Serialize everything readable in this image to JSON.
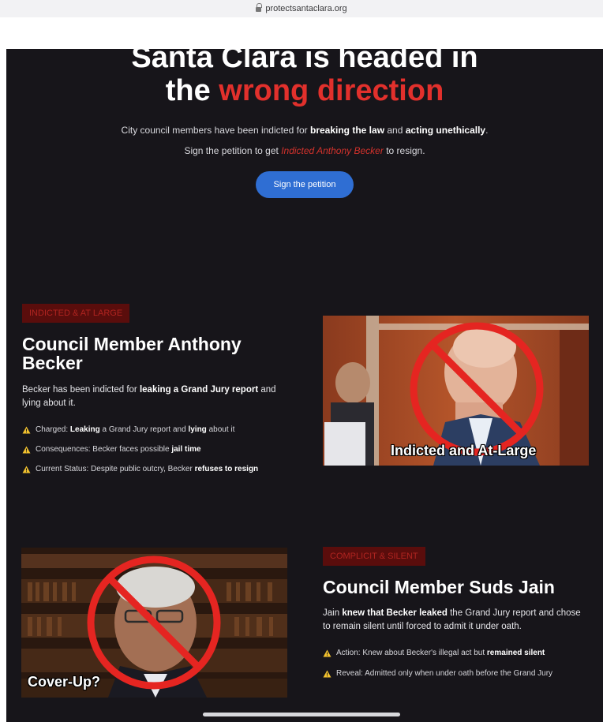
{
  "browser": {
    "url": "protectsantaclara.org"
  },
  "hero": {
    "title_line1": "Santa Clara is headed in",
    "title_line2_prefix": "the",
    "title_line2_red": "wrong direction",
    "sub_text1": "City council members have been indicted for",
    "sub_bold1": "breaking the law",
    "sub_text2": "and",
    "sub_bold2": "acting unethically",
    "sub_text3": ".",
    "sign_text1": "Sign the petition to get",
    "sign_red": "Indicted Anthony Becker",
    "sign_text2": "to resign.",
    "cta_label": "Sign the petition"
  },
  "becker": {
    "badge": "INDICTED & AT LARGE",
    "title": "Council Member Anthony Becker",
    "desc_pre": "Becker has been indicted for",
    "desc_bold": "leaking a Grand Jury report",
    "desc_post": "and lying about it.",
    "bullets": [
      {
        "pre": "Charged:",
        "b1": "Leaking",
        "mid": "a Grand Jury report and",
        "b2": "lying",
        "post": "about it"
      },
      {
        "pre": "Consequences: Becker faces possible",
        "b1": "jail time",
        "mid": "",
        "b2": "",
        "post": ""
      },
      {
        "pre": "Current Status: Despite public outcry, Becker",
        "b1": "refuses to resign",
        "mid": "",
        "b2": "",
        "post": ""
      }
    ],
    "photo_caption": "Indicted and At-Large"
  },
  "jain": {
    "badge": "COMPLICIT & SILENT",
    "title": "Council Member Suds Jain",
    "desc_pre": "Jain",
    "desc_bold": "knew that Becker leaked",
    "desc_post": "the Grand Jury report and chose to remain silent until forced to admit it under oath.",
    "bullets": [
      {
        "pre": "Action: Knew about Becker's illegal act but",
        "b1": "remained silent"
      },
      {
        "pre": "Reveal: Admitted only when under oath before the Grand Jury",
        "b1": ""
      }
    ],
    "photo_caption": "Cover-Up?"
  },
  "colors": {
    "background": "#17151a",
    "accent_red": "#e2302c",
    "button_blue": "#2f6ed3",
    "badge_bg": "#5a0d0c"
  },
  "icons": [
    "lock-icon",
    "warning-icon",
    "prohibited-sign-icon"
  ]
}
